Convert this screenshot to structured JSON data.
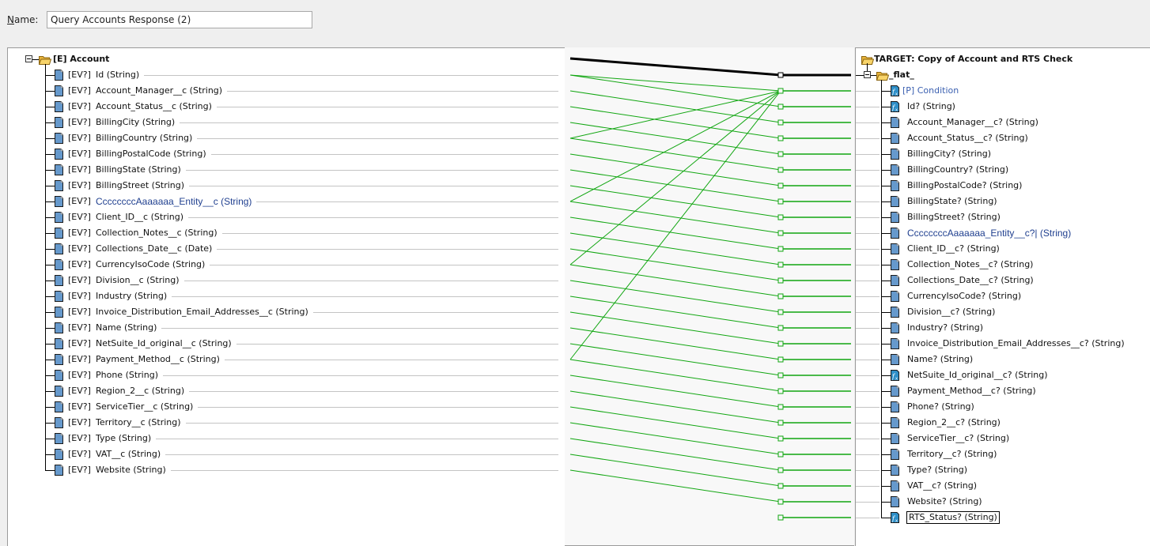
{
  "header": {
    "name_label_accel": "N",
    "name_label_rest": "ame:",
    "name_value": "Query Accounts Response (2)"
  },
  "source": {
    "root_label": "[E] Account",
    "items": [
      {
        "prefix": "[EV?]",
        "label": "Id (String)",
        "highlight": false
      },
      {
        "prefix": "[EV?]",
        "label": "Account_Manager__c (String)",
        "highlight": false
      },
      {
        "prefix": "[EV?]",
        "label": "Account_Status__c (String)",
        "highlight": false
      },
      {
        "prefix": "[EV?]",
        "label": "BillingCity (String)",
        "highlight": false
      },
      {
        "prefix": "[EV?]",
        "label": "BillingCountry (String)",
        "highlight": false
      },
      {
        "prefix": "[EV?]",
        "label": "BillingPostalCode (String)",
        "highlight": false
      },
      {
        "prefix": "[EV?]",
        "label": "BillingState (String)",
        "highlight": false
      },
      {
        "prefix": "[EV?]",
        "label": "BillingStreet (String)",
        "highlight": false
      },
      {
        "prefix": "[EV?]",
        "label": "CcccccccAaaaaaa_Entity__c (String)",
        "highlight": true
      },
      {
        "prefix": "[EV?]",
        "label": "Client_ID__c (String)",
        "highlight": false
      },
      {
        "prefix": "[EV?]",
        "label": "Collection_Notes__c (String)",
        "highlight": false
      },
      {
        "prefix": "[EV?]",
        "label": "Collections_Date__c (Date)",
        "highlight": false
      },
      {
        "prefix": "[EV?]",
        "label": "CurrencyIsoCode (String)",
        "highlight": false
      },
      {
        "prefix": "[EV?]",
        "label": "Division__c (String)",
        "highlight": false
      },
      {
        "prefix": "[EV?]",
        "label": "Industry (String)",
        "highlight": false
      },
      {
        "prefix": "[EV?]",
        "label": "Invoice_Distribution_Email_Addresses__c (String)",
        "highlight": false
      },
      {
        "prefix": "[EV?]",
        "label": "Name (String)",
        "highlight": false
      },
      {
        "prefix": "[EV?]",
        "label": "NetSuite_Id_original__c (String)",
        "highlight": false
      },
      {
        "prefix": "[EV?]",
        "label": "Payment_Method__c (String)",
        "highlight": false
      },
      {
        "prefix": "[EV?]",
        "label": "Phone (String)",
        "highlight": false
      },
      {
        "prefix": "[EV?]",
        "label": "Region_2__c (String)",
        "highlight": false
      },
      {
        "prefix": "[EV?]",
        "label": "ServiceTier__c (String)",
        "highlight": false
      },
      {
        "prefix": "[EV?]",
        "label": "Territory__c (String)",
        "highlight": false
      },
      {
        "prefix": "[EV?]",
        "label": "Type (String)",
        "highlight": false
      },
      {
        "prefix": "[EV?]",
        "label": "VAT__c (String)",
        "highlight": false
      },
      {
        "prefix": "[EV?]",
        "label": "Website (String)",
        "highlight": false
      }
    ]
  },
  "target": {
    "root_label": "TARGET: Copy of Account and RTS Check",
    "group_label": "_flat_",
    "items": [
      {
        "label": "[P] Condition",
        "icon": "fx",
        "style": "param"
      },
      {
        "label": "Id? (String)",
        "icon": "fx",
        "style": "normal"
      },
      {
        "label": "Account_Manager__c? (String)",
        "icon": "doc",
        "style": "normal"
      },
      {
        "label": "Account_Status__c? (String)",
        "icon": "doc",
        "style": "normal"
      },
      {
        "label": "BillingCity? (String)",
        "icon": "doc",
        "style": "normal"
      },
      {
        "label": "BillingCountry? (String)",
        "icon": "doc",
        "style": "normal"
      },
      {
        "label": "BillingPostalCode? (String)",
        "icon": "doc",
        "style": "normal"
      },
      {
        "label": "BillingState? (String)",
        "icon": "doc",
        "style": "normal"
      },
      {
        "label": "BillingStreet? (String)",
        "icon": "doc",
        "style": "normal"
      },
      {
        "label": "CcccccccAaaaaaa_Entity__c?| (String)",
        "icon": "doc",
        "style": "highlight"
      },
      {
        "label": "Client_ID__c? (String)",
        "icon": "doc",
        "style": "normal"
      },
      {
        "label": "Collection_Notes__c? (String)",
        "icon": "doc",
        "style": "normal"
      },
      {
        "label": "Collections_Date__c? (String)",
        "icon": "doc",
        "style": "normal"
      },
      {
        "label": "CurrencyIsoCode? (String)",
        "icon": "doc",
        "style": "normal"
      },
      {
        "label": "Division__c? (String)",
        "icon": "doc",
        "style": "normal"
      },
      {
        "label": "Industry? (String)",
        "icon": "doc",
        "style": "normal"
      },
      {
        "label": "Invoice_Distribution_Email_Addresses__c? (String)",
        "icon": "doc",
        "style": "normal"
      },
      {
        "label": "Name? (String)",
        "icon": "doc",
        "style": "normal"
      },
      {
        "label": "NetSuite_Id_original__c? (String)",
        "icon": "fx",
        "style": "normal"
      },
      {
        "label": "Payment_Method__c? (String)",
        "icon": "doc",
        "style": "normal"
      },
      {
        "label": "Phone? (String)",
        "icon": "doc",
        "style": "normal"
      },
      {
        "label": "Region_2__c? (String)",
        "icon": "doc",
        "style": "normal"
      },
      {
        "label": "ServiceTier__c? (String)",
        "icon": "doc",
        "style": "normal"
      },
      {
        "label": "Territory__c? (String)",
        "icon": "doc",
        "style": "normal"
      },
      {
        "label": "Type? (String)",
        "icon": "doc",
        "style": "normal"
      },
      {
        "label": "VAT__c? (String)",
        "icon": "doc",
        "style": "normal"
      },
      {
        "label": "Website? (String)",
        "icon": "doc",
        "style": "normal"
      },
      {
        "label": "RTS_Status? (String)",
        "icon": "fx",
        "style": "selected"
      }
    ]
  },
  "mappings": {
    "root_link": {
      "from": "source-root",
      "to": "target-group"
    },
    "links": [
      {
        "from": 0,
        "to": 0
      },
      {
        "from": 4,
        "to": 0
      },
      {
        "from": 8,
        "to": 0
      },
      {
        "from": 12,
        "to": 0
      },
      {
        "from": 18,
        "to": 0
      },
      {
        "from": 0,
        "to": 1
      },
      {
        "from": 1,
        "to": 2
      },
      {
        "from": 2,
        "to": 3
      },
      {
        "from": 3,
        "to": 4
      },
      {
        "from": 4,
        "to": 5
      },
      {
        "from": 5,
        "to": 6
      },
      {
        "from": 6,
        "to": 7
      },
      {
        "from": 7,
        "to": 8
      },
      {
        "from": 8,
        "to": 9
      },
      {
        "from": 9,
        "to": 10
      },
      {
        "from": 10,
        "to": 11
      },
      {
        "from": 11,
        "to": 12
      },
      {
        "from": 12,
        "to": 13
      },
      {
        "from": 13,
        "to": 14
      },
      {
        "from": 14,
        "to": 15
      },
      {
        "from": 15,
        "to": 16
      },
      {
        "from": 16,
        "to": 17
      },
      {
        "from": 17,
        "to": 18
      },
      {
        "from": 18,
        "to": 19
      },
      {
        "from": 19,
        "to": 20
      },
      {
        "from": 20,
        "to": 21
      },
      {
        "from": 21,
        "to": 22
      },
      {
        "from": 22,
        "to": 23
      },
      {
        "from": 23,
        "to": 24
      },
      {
        "from": 24,
        "to": 25
      },
      {
        "from": 25,
        "to": 26
      }
    ],
    "unmapped_targets": [
      27
    ],
    "colors": {
      "link": "#11a611",
      "root_link": "#000000"
    }
  }
}
